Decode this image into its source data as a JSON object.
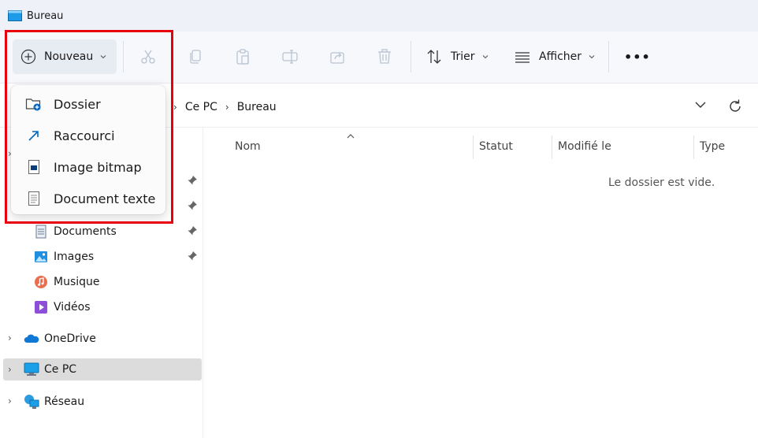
{
  "window": {
    "title": "Bureau"
  },
  "toolbar": {
    "new_label": "Nouveau",
    "sort_label": "Trier",
    "view_label": "Afficher",
    "more_label": "•••"
  },
  "address": {
    "crumbs": [
      "Ce PC",
      "Bureau"
    ]
  },
  "new_menu": {
    "items": [
      {
        "label": "Dossier",
        "icon": "new-folder-icon"
      },
      {
        "label": "Raccourci",
        "icon": "shortcut-icon"
      },
      {
        "label": "Image bitmap",
        "icon": "bitmap-icon"
      },
      {
        "label": "Document texte",
        "icon": "text-document-icon"
      }
    ]
  },
  "nav": {
    "quick_access": [
      {
        "label": "Documents",
        "icon": "documents-icon",
        "pinned": true
      },
      {
        "label": "Images",
        "icon": "images-icon",
        "pinned": true
      },
      {
        "label": "Musique",
        "icon": "music-icon",
        "pinned": false
      },
      {
        "label": "Vidéos",
        "icon": "videos-icon",
        "pinned": false
      }
    ],
    "roots": [
      {
        "label": "OneDrive",
        "icon": "onedrive-icon",
        "selected": false
      },
      {
        "label": "Ce PC",
        "icon": "this-pc-icon",
        "selected": true
      },
      {
        "label": "Réseau",
        "icon": "network-icon",
        "selected": false
      }
    ]
  },
  "content": {
    "columns": [
      "Nom",
      "Statut",
      "Modifié le",
      "Type"
    ],
    "empty_message": "Le dossier est vide."
  },
  "colors": {
    "accent": "#0067c0",
    "highlight": "#e8000e"
  }
}
